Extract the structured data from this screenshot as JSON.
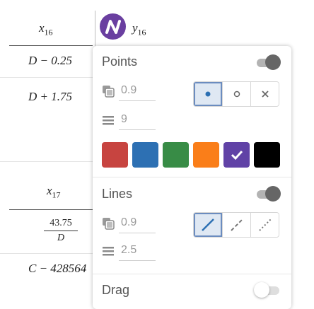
{
  "table": {
    "col1_header": {
      "var": "x",
      "sub": "16"
    },
    "col2_header": {
      "var": "y",
      "sub": "16"
    },
    "row1": "D − 0.25",
    "row2": "D + 1.75",
    "col3_header": {
      "var": "x",
      "sub": "17"
    },
    "frac_num": "43.75",
    "frac_den": "D",
    "row4": "C − 428564"
  },
  "popup": {
    "points": {
      "title": "Points",
      "enabled": true,
      "opacity": "0.9",
      "size": "9",
      "style_options": [
        "filled-dot-icon",
        "open-dot-icon",
        "cross-icon"
      ],
      "selected_style": "filled-dot-icon"
    },
    "colors": [
      "#c74440",
      "#2d70b3",
      "#388c46",
      "#fa7e19",
      "#6042a6",
      "#000000"
    ],
    "selected_color": "#6042a6",
    "lines": {
      "title": "Lines",
      "enabled": true,
      "opacity": "0.9",
      "width": "2.5",
      "style_options": [
        "solid-line-icon",
        "dashed-line-icon",
        "dotted-line-icon"
      ],
      "selected_style": "solid-line-icon"
    },
    "drag": {
      "title": "Drag",
      "enabled": false
    }
  }
}
